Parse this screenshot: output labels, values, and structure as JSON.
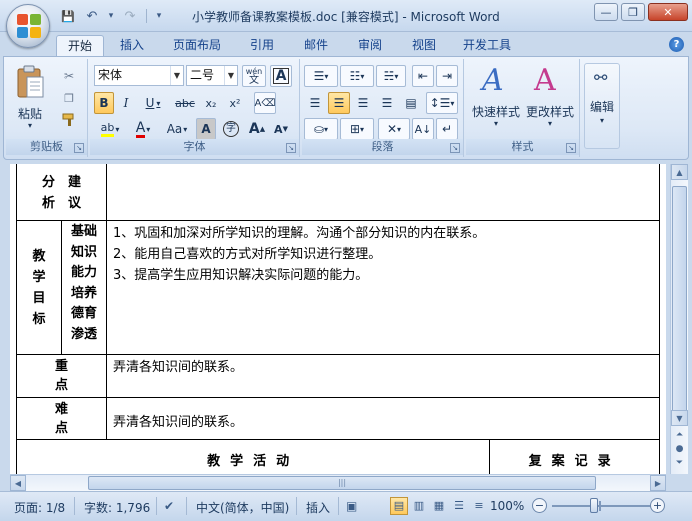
{
  "window": {
    "title": "小学教师备课教案模板.doc [兼容模式] - Microsoft Word",
    "minimize_glyph": "—",
    "restore_glyph": "❐",
    "close_glyph": "✕"
  },
  "quick_access": {
    "save_glyph": "💾",
    "undo_glyph": "↶",
    "undo_dropdown_glyph": "▾",
    "redo_glyph": "↷",
    "customize_glyph": "▾"
  },
  "ribbon_tabs": [
    "开始",
    "插入",
    "页面布局",
    "引用",
    "邮件",
    "审阅",
    "视图",
    "开发工具"
  ],
  "help_glyph": "?",
  "clipboard": {
    "paste_label": "粘贴",
    "group_label": "剪贴板"
  },
  "font": {
    "name": "宋体",
    "size": "二号",
    "group_label": "字体",
    "wen_label": "wén",
    "bold": "B",
    "italic": "I",
    "underline": "U",
    "strike": "abc",
    "subscript": "x₂",
    "superscript": "x²",
    "case": "Aa",
    "char_shading": "A",
    "enclose": "字",
    "grow": "A",
    "shrink": "A",
    "highlight": "ab",
    "color": "A"
  },
  "paragraph": {
    "group_label": "段落"
  },
  "styles": {
    "quick_styles_label": "快速样式",
    "change_styles_label": "更改样式",
    "group_label": "样式"
  },
  "editing": {
    "label": "编辑"
  },
  "document": {
    "row1": {
      "label": "分　建\n析　议"
    },
    "row2": {
      "label": "教\n学\n目\n标",
      "sublabels": "基础\n知识\n能力\n培养\n德育\n渗透",
      "lines": [
        "1、巩固和加深对所学知识的理解。沟通个部分知识的内在联系。",
        "2、能用自己喜欢的方式对所学知识进行整理。",
        "3、提高学生应用知识解决实际问题的能力。"
      ]
    },
    "row3": {
      "label": "重点",
      "content": "弄清各知识间的联系。"
    },
    "row4": {
      "label": "难点",
      "content": "弄清各知识间的联系。"
    },
    "row5": {
      "activity": "教学活动",
      "record": "复案记录"
    }
  },
  "status": {
    "page": "页面: 1/8",
    "words": "字数: 1,796",
    "language": "中文(简体，中国)",
    "insert_mode": "插入",
    "zoom": "100%",
    "zoom_level_percent": 100
  }
}
